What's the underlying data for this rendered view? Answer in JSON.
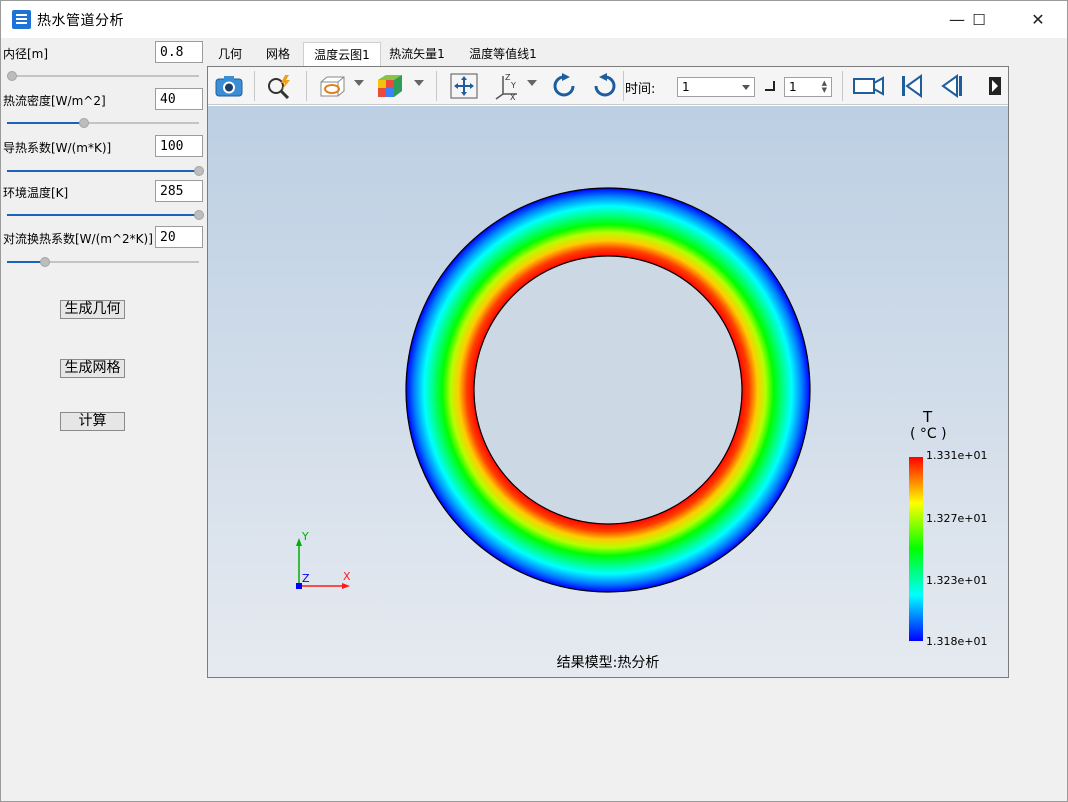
{
  "window": {
    "title": "热水管道分析",
    "minimize": "—",
    "maximize": "☐",
    "close": "✕"
  },
  "params": [
    {
      "label": "内径[m]",
      "value": "0.8",
      "slider_fraction": 0.0
    },
    {
      "label": "热流密度[W/m^2]",
      "value": "40",
      "slider_fraction": 0.4
    },
    {
      "label": "导热系数[W/(m*K)]",
      "value": "100",
      "slider_fraction": 1.0
    },
    {
      "label": "环境温度[K]",
      "value": "285",
      "slider_fraction": 1.0
    },
    {
      "label": "对流换热系数[W/(m^2*K)]",
      "value": "20",
      "slider_fraction": 0.2
    }
  ],
  "buttons": {
    "geometry": "生成几何",
    "mesh": "生成网格",
    "compute": "计算"
  },
  "tabs": [
    "几何",
    "网格",
    "温度云图1",
    "热流矢量1",
    "温度等值线1"
  ],
  "active_tab": 2,
  "toolbar": {
    "time_label": "时间:",
    "time_value": "1",
    "step_value": "1",
    "icons": [
      "camera-icon",
      "zoom-icon",
      "view-box-icon",
      "color-cube-icon",
      "fit-icon",
      "axes-icon",
      "rotate-cw-icon",
      "rotate-ccw-icon",
      "video-icon",
      "first-frame-icon",
      "prev-frame-icon",
      "next-frame-icon"
    ]
  },
  "viewport": {
    "caption": "结果模型:热分析",
    "axes": {
      "x": "X",
      "y": "Y",
      "z": "Z"
    },
    "legend": {
      "title": "T",
      "unit": "( °C )",
      "ticks": [
        "1.331e+01",
        "1.327e+01",
        "1.323e+01",
        "1.318e+01"
      ]
    }
  },
  "colors": {
    "accent": "#1a63b8",
    "ring_inner": "#ff0000",
    "ring_outer": "#0000ff"
  }
}
